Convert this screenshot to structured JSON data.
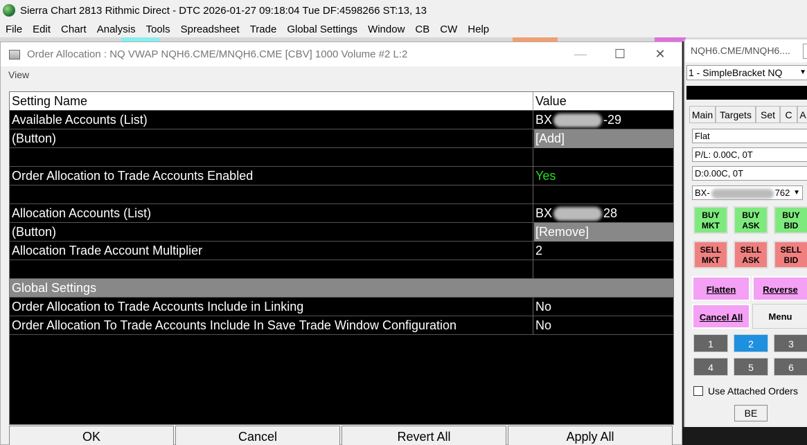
{
  "app": {
    "title": "Sierra Chart 2813 Rithmic Direct - DTC 2026-01-27  09:18:04 Tue DF:4598266  ST:13, 13",
    "menu": [
      "File",
      "Edit",
      "Chart",
      "Analysis",
      "Tools",
      "Spreadsheet",
      "Trade",
      "Global Settings",
      "Window",
      "CB",
      "CW",
      "Help"
    ]
  },
  "dialog": {
    "title": "Order Allocation : NQ VWAP NQH6.CME/MNQH6.CME [CBV]  1000 Volume #2 L:2",
    "view_menu": "View",
    "minimize": "—",
    "maximize": "☐",
    "close": "✕",
    "header": {
      "name": "Setting Name",
      "value": "Value"
    },
    "rows": [
      {
        "name": "Available Accounts (List)",
        "value_pre": "BX",
        "value_post": "-29"
      },
      {
        "name": " (Button)",
        "value": "[Add]"
      },
      {
        "name": "",
        "value": ""
      },
      {
        "name": "Order Allocation to Trade Accounts Enabled",
        "value": "Yes"
      },
      {
        "name": "",
        "value": ""
      },
      {
        "name": "Allocation Accounts (List)",
        "value_pre": "BX",
        "value_post": "28"
      },
      {
        "name": " (Button)",
        "value": "[Remove]"
      },
      {
        "name": "Allocation Trade Account Multiplier",
        "value": "2"
      },
      {
        "name": "",
        "value": ""
      },
      {
        "name": "Global Settings",
        "value": ""
      },
      {
        "name": "Order Allocation to Trade Accounts Include in Linking",
        "value": "No"
      },
      {
        "name": "Order Allocation To Trade Accounts Include In Save Trade Window Configuration",
        "value": "No"
      }
    ],
    "buttons": {
      "ok": "OK",
      "cancel": "Cancel",
      "revert": "Revert All",
      "apply": "Apply All"
    },
    "colors": {
      "enabled_yes": "#22e022",
      "section_gray": "#888888"
    }
  },
  "trade_panel": {
    "title": "NQH6.CME/MNQH6....",
    "strategy": "1 - SimpleBracket NQ",
    "tabs": [
      "Main",
      "Targets",
      "Set",
      "C",
      "A"
    ],
    "position": "Flat",
    "pl": "P/L: 0.00C, 0T",
    "daily": "D:0.00C, 0T",
    "account_pre": "BX-",
    "account_post": "762",
    "buy_mkt": "BUY\nMKT",
    "buy_ask": "BUY\nASK",
    "buy_bid": "BUY\nBID",
    "sell_mkt": "SELL\nMKT",
    "sell_ask": "SELL\nASK",
    "sell_bid": "SELL\nBID",
    "flatten": "Flatten",
    "reverse": "Reverse",
    "cancel_all": "Cancel All",
    "menu": "Menu",
    "quantities": [
      "1",
      "2",
      "3",
      "4",
      "5",
      "6"
    ],
    "selected_quantity": "2",
    "use_attached": "Use Attached Orders",
    "be": "BE",
    "colors": {
      "buy": "#7eea7e",
      "sell": "#f08080",
      "pink": "#f4a0f4",
      "selected": "#1e90e0"
    }
  }
}
